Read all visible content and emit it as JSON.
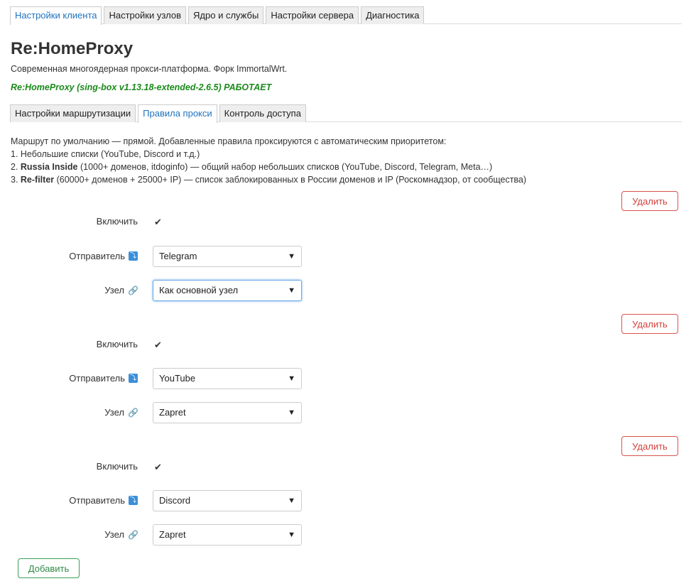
{
  "main_tabs": [
    {
      "label": "Настройки клиента",
      "active": true
    },
    {
      "label": "Настройки узлов",
      "active": false
    },
    {
      "label": "Ядро и службы",
      "active": false
    },
    {
      "label": "Настройки сервера",
      "active": false
    },
    {
      "label": "Диагностика",
      "active": false
    }
  ],
  "title": "Re:HomeProxy",
  "subtitle": "Современная многоядерная прокси-платформа. Форк ImmortalWrt.",
  "status": "Re:HomeProxy (sing-box v1.13.18-extended-2.6.5) РАБОТАЕТ",
  "sub_tabs": [
    {
      "label": "Настройки маршрутизации",
      "active": false
    },
    {
      "label": "Правила прокси",
      "active": true
    },
    {
      "label": "Контроль доступа",
      "active": false
    }
  ],
  "info": {
    "intro": "Маршрут по умолчанию — прямой. Добавленные правила проксируются с автоматическим приоритетом:",
    "line1": "1. Небольшие списки (YouTube, Discord и т.д.)",
    "line2_prefix": "2. ",
    "line2_bold": "Russia Inside",
    "line2_rest": " (1000+ доменов, itdoginfo) — общий набор небольших списков (YouTube, Discord, Telegram, Meta…)",
    "line3_prefix": "3. ",
    "line3_bold": "Re-filter",
    "line3_rest": " (60000+ доменов + 25000+ IP) — список заблокированных в России доменов и IP (Роскомнадзор, от сообщества)"
  },
  "labels": {
    "enable": "Включить",
    "sender": "Отправитель",
    "node": "Узел",
    "delete": "Удалить",
    "add": "Добавить"
  },
  "rules": [
    {
      "enabled": true,
      "sender": "Telegram",
      "node": "Как основной узел"
    },
    {
      "enabled": true,
      "sender": "YouTube",
      "node": "Zapret"
    },
    {
      "enabled": true,
      "sender": "Discord",
      "node": "Zapret"
    }
  ],
  "colors": {
    "accent": "#1e73be",
    "status": "#1a8a1a",
    "delete": "#d43f3a",
    "add": "#2e8b46"
  }
}
